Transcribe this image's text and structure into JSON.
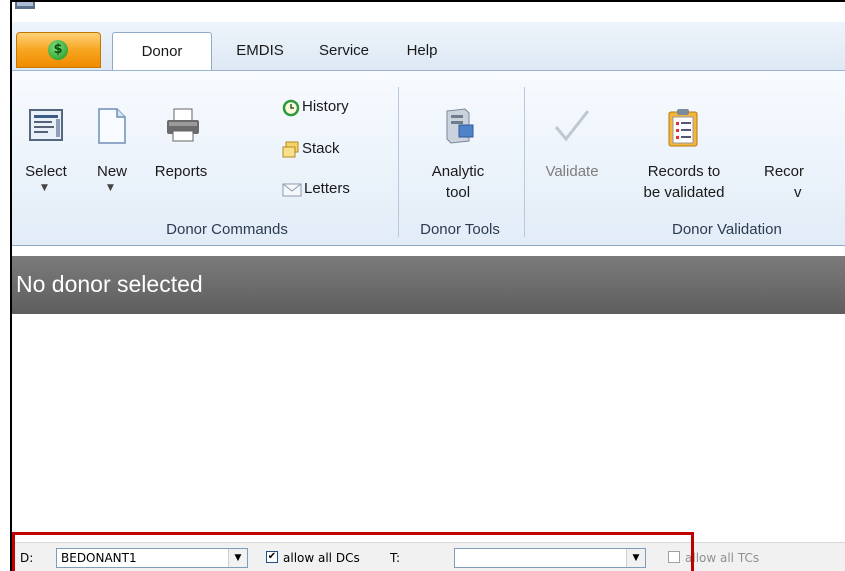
{
  "tabs": {
    "orb_symbol": "$",
    "items": [
      "Donor",
      "EMDIS",
      "Service",
      "Help"
    ]
  },
  "ribbon": {
    "donor_commands": {
      "select": "Select",
      "new": "New",
      "reports": "Reports",
      "history": "History",
      "stack": "Stack",
      "letters": "Letters",
      "group": "Donor Commands"
    },
    "donor_tools": {
      "analytic_line1": "Analytic",
      "analytic_line2": "tool",
      "group": "Donor Tools"
    },
    "donor_validation": {
      "validate": "Validate",
      "records_line1": "Records to",
      "records_line2": "be validated",
      "reco_line1": "Recor",
      "reco_line2": "v",
      "group": "Donor Validation"
    }
  },
  "header": {
    "title": "No donor selected"
  },
  "statusbar": {
    "d_label": "D:",
    "d_value": "BEDONANT1",
    "allow_dcs": "allow all DCs",
    "allow_dcs_checked": true,
    "t_label": "T:",
    "t_value": "",
    "allow_tcs": "allow all TCs",
    "allow_tcs_checked": false
  },
  "colors": {
    "highlight_box": "#c00000",
    "header_bg": "#6b6b6b",
    "orb": "#f7a520"
  }
}
